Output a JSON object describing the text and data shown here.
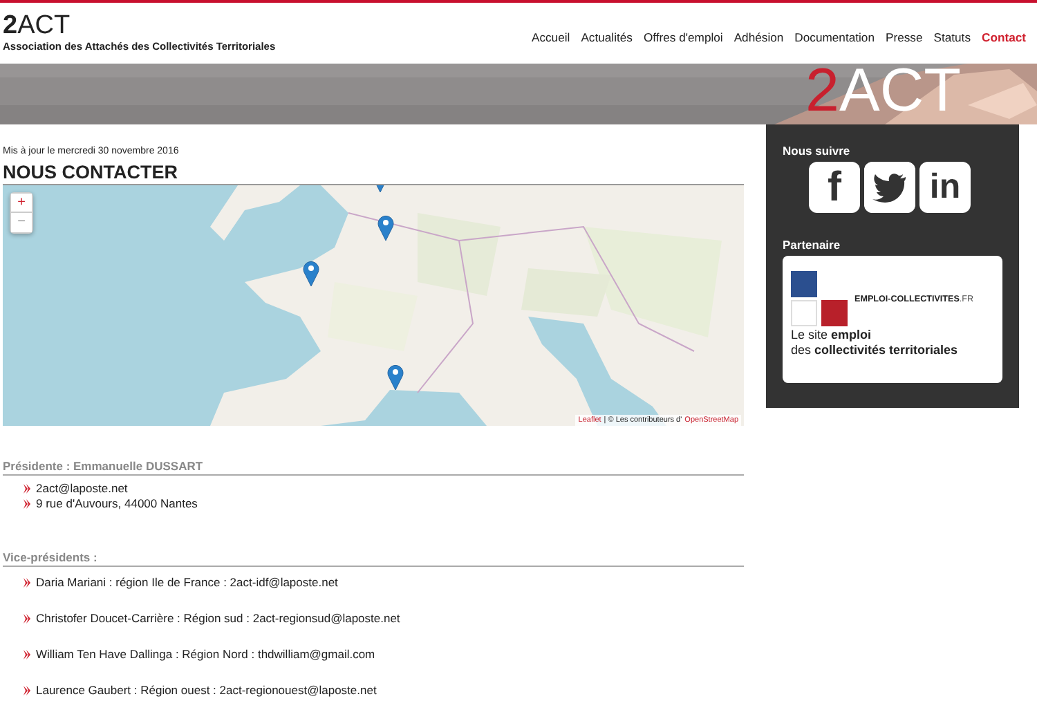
{
  "header": {
    "logo_number": "2",
    "logo_letters": "ACT",
    "tagline": "Association des Attachés des Collectivités Territoriales"
  },
  "nav": [
    {
      "label": "Accueil",
      "selected": false
    },
    {
      "label": "Actualités",
      "selected": false
    },
    {
      "label": "Offres d'emploi",
      "selected": false
    },
    {
      "label": "Adhésion",
      "selected": false
    },
    {
      "label": "Documentation",
      "selected": false
    },
    {
      "label": "Presse",
      "selected": false
    },
    {
      "label": "Statuts",
      "selected": false
    },
    {
      "label": "Contact",
      "selected": true
    }
  ],
  "banner": {
    "logo_number": "2",
    "logo_letters": "ACT"
  },
  "updated": "Mis à jour le mercredi 30 novembre 2016",
  "title": "NOUS CONTACTER",
  "map": {
    "zoom_in": "+",
    "zoom_out": "−",
    "attribution_link": "Leaflet",
    "attribution_text": "| © Les contributeurs d'",
    "attribution_source": "OpenStreetMap"
  },
  "sections": [
    {
      "heading": "Présidente : Emmanuelle DUSSART",
      "kind": "compact",
      "items": [
        "2act@laposte.net",
        "9 rue d'Auvours, 44000 Nantes"
      ]
    },
    {
      "heading": "Vice-présidents :",
      "kind": "spread",
      "items": [
        "Daria Mariani : région Ile de France : 2act-idf@laposte.net",
        "Christofer Doucet-Carrière : Région sud : 2act-regionsud@laposte.net",
        "William Ten Have Dallinga : Région Nord : thdwilliam@gmail.com",
        "Laurence Gaubert : Région ouest : 2act-regionouest@laposte.net"
      ]
    }
  ],
  "sidebar": {
    "follow_title": "Nous suivre",
    "social": [
      {
        "kind": "facebook",
        "glyph": "f"
      },
      {
        "kind": "twitter"
      },
      {
        "kind": "linkedin",
        "glyph": "in"
      }
    ],
    "partner_title": "Partenaire",
    "partner": {
      "name": "EMPLOI-COLLECTIVITES",
      "suffix": ".FR",
      "line_1": "Le site **emploi**",
      "line_2": "des **collectivités territoriales**"
    }
  }
}
